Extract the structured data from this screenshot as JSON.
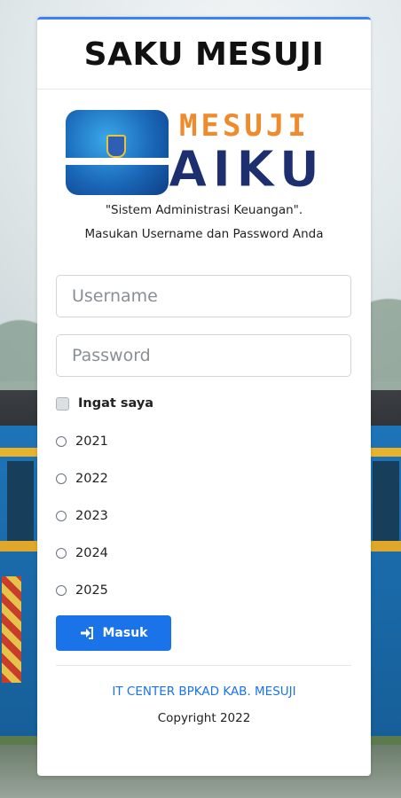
{
  "app": {
    "title": "SAKU MESUJI"
  },
  "logo": {
    "top_word": "MESUJI",
    "bottom_word": "AIKU",
    "alt": "Logo SAKU MESUJI"
  },
  "tagline": {
    "line1": "\"Sistem Administrasi Keuangan\".",
    "line2": "Masukan Username dan Password Anda"
  },
  "form": {
    "username_placeholder": "Username",
    "password_placeholder": "Password",
    "remember_label": "Ingat saya",
    "remember_checked": false,
    "years": [
      "2021",
      "2022",
      "2023",
      "2024",
      "2025"
    ],
    "submit_label": "Masuk",
    "submit_icon": "sign-in-icon"
  },
  "footer": {
    "org_link": "IT CENTER BPKAD KAB. MESUJI",
    "copyright": "Copyright 2022"
  },
  "colors": {
    "accent": "#1a73e8",
    "top_border": "#3b82f6",
    "logo_orange": "#f08a2b",
    "logo_navy": "#1d2f6f"
  }
}
